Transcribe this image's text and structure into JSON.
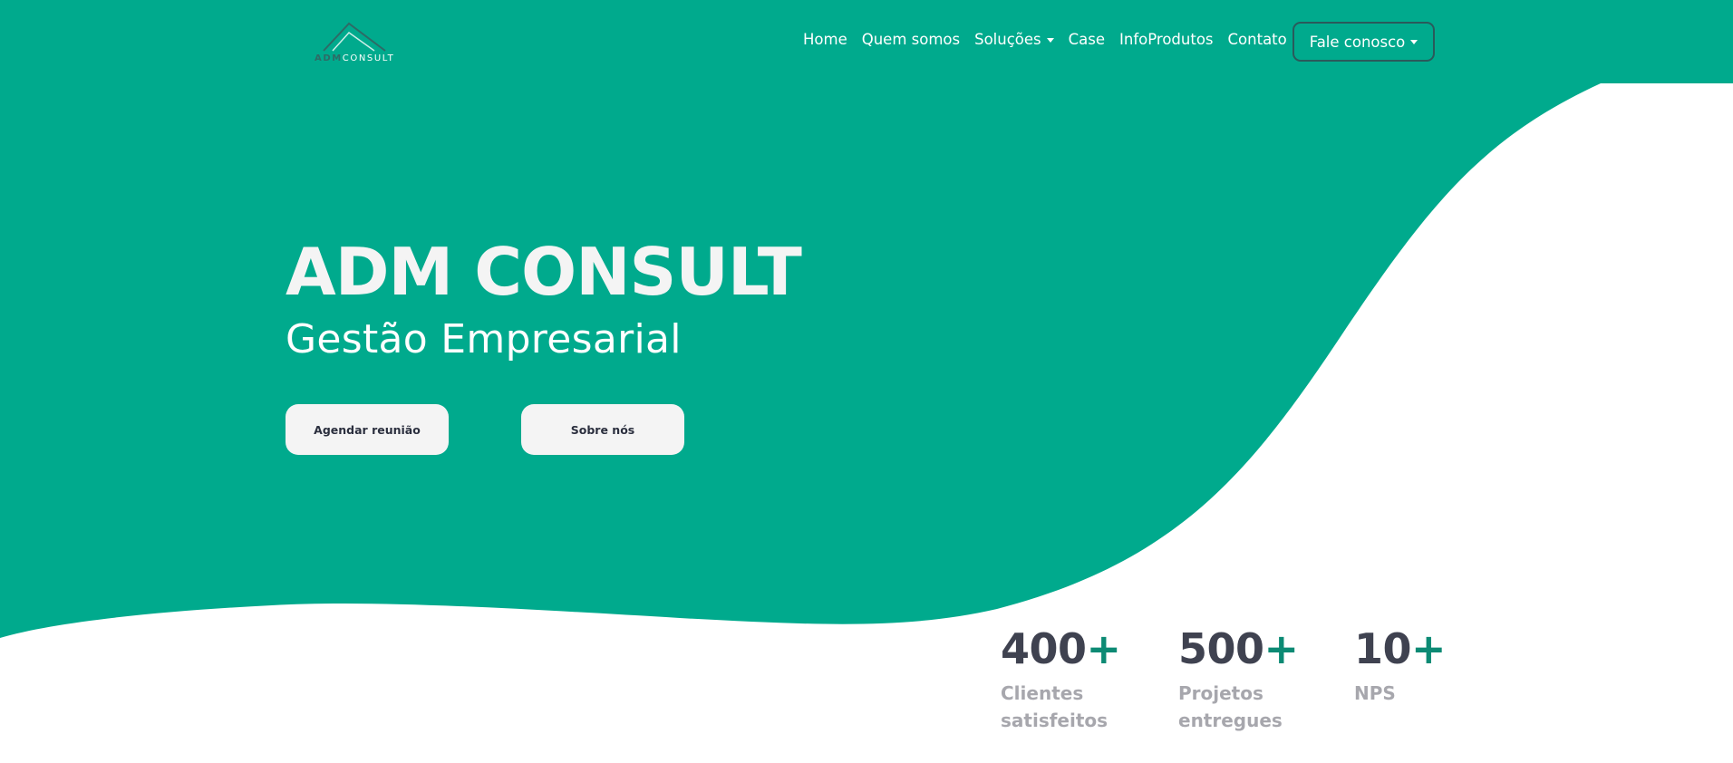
{
  "brand": {
    "logo_part1": "ADM",
    "logo_part2": "CONSULT",
    "primary_color": "#00aa8d",
    "accent_color": "#0c8a74",
    "dark_text_color": "#3f4250"
  },
  "nav": {
    "items": [
      {
        "label": "Home"
      },
      {
        "label": "Quem somos"
      },
      {
        "label": "Soluções",
        "dropdown": true
      },
      {
        "label": "Case"
      },
      {
        "label": "InfoProdutos"
      },
      {
        "label": "Contato"
      }
    ],
    "cta_label": "Fale conosco"
  },
  "hero": {
    "title": "ADM CONSULT",
    "subtitle": "Gestão Empresarial",
    "primary_button": "Agendar reunião",
    "secondary_button": "Sobre nós"
  },
  "stats": [
    {
      "number": "400",
      "suffix": "+",
      "label_line1": "Clientes",
      "label_line2": "satisfeitos"
    },
    {
      "number": "500",
      "suffix": "+",
      "label_line1": "Projetos",
      "label_line2": "entregues"
    },
    {
      "number": "10",
      "suffix": "+",
      "label_line1": "NPS",
      "label_line2": ""
    }
  ]
}
